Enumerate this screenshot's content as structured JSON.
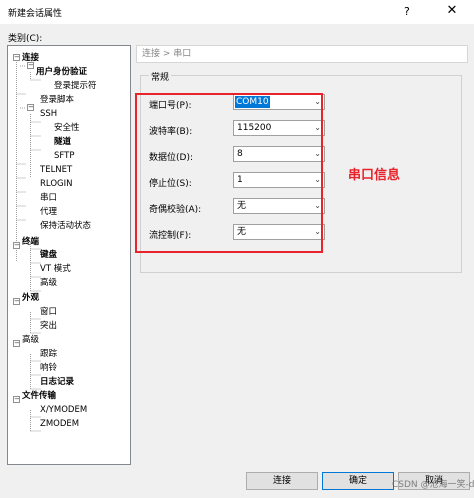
{
  "window": {
    "title": "新建会话属性",
    "help_glyph": "?",
    "close_glyph": "✕"
  },
  "category_label": "类别(C):",
  "tree": [
    {
      "label": "连接",
      "bold": true
    },
    {
      "label": "用户身份验证",
      "bold": true
    },
    {
      "label": "登录提示符",
      "bold": false
    },
    {
      "label": "登录脚本",
      "bold": false
    },
    {
      "label": "SSH",
      "bold": false
    },
    {
      "label": "安全性",
      "bold": false
    },
    {
      "label": "隧道",
      "bold": true
    },
    {
      "label": "SFTP",
      "bold": false
    },
    {
      "label": "TELNET",
      "bold": false
    },
    {
      "label": "RLOGIN",
      "bold": false
    },
    {
      "label": "串口",
      "bold": false
    },
    {
      "label": "代理",
      "bold": false
    },
    {
      "label": "保持活动状态",
      "bold": false
    },
    {
      "label": "终端",
      "bold": true
    },
    {
      "label": "键盘",
      "bold": true
    },
    {
      "label": "VT 模式",
      "bold": false
    },
    {
      "label": "高级",
      "bold": false
    },
    {
      "label": "外观",
      "bold": true
    },
    {
      "label": "窗口",
      "bold": false
    },
    {
      "label": "突出",
      "bold": false
    },
    {
      "label": "高级",
      "bold": false
    },
    {
      "label": "跟踪",
      "bold": false
    },
    {
      "label": "响铃",
      "bold": false
    },
    {
      "label": "日志记录",
      "bold": true
    },
    {
      "label": "文件传输",
      "bold": true
    },
    {
      "label": "X/YMODEM",
      "bold": false
    },
    {
      "label": "ZMODEM",
      "bold": false
    }
  ],
  "breadcrumb": "连接 > 串口",
  "group": {
    "title": "常规",
    "fields": [
      {
        "label": "端口号(P):",
        "value": "COM10"
      },
      {
        "label": "波特率(B):",
        "value": "115200"
      },
      {
        "label": "数据位(D):",
        "value": "8"
      },
      {
        "label": "停止位(S):",
        "value": "1"
      },
      {
        "label": "奇偶校验(A):",
        "value": "无"
      },
      {
        "label": "流控制(F):",
        "value": "无"
      }
    ]
  },
  "annotation": "串口信息",
  "buttons": {
    "connect": "连接",
    "ok": "确定",
    "cancel": "取消"
  },
  "watermark": "CSDN @沧海一笑-dj",
  "colors": {
    "annotation": "#e8232b",
    "selection": "#0078d7"
  }
}
